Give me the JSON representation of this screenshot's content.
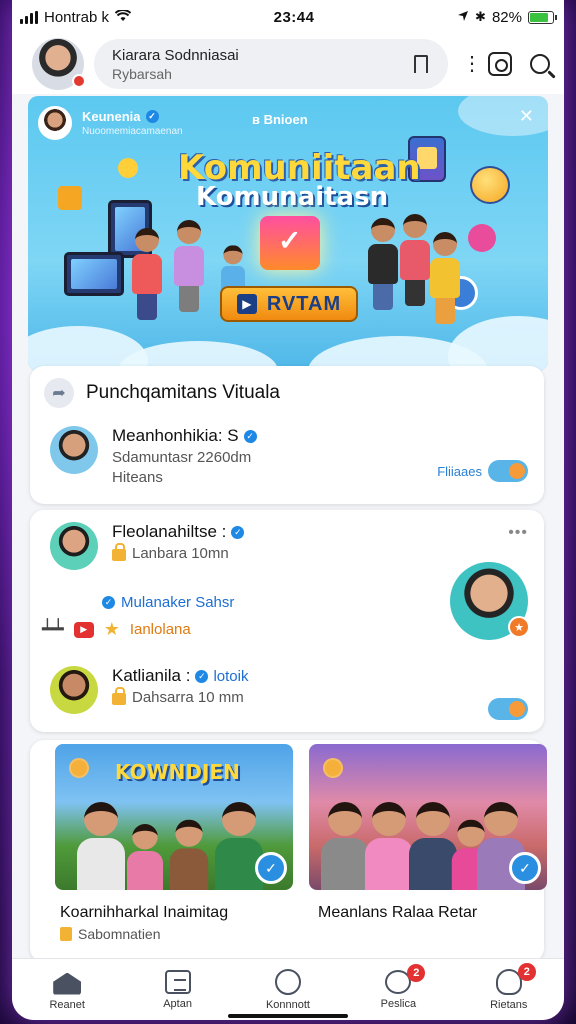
{
  "status_bar": {
    "carrier": "Hontrab k",
    "time": "23:44",
    "battery_text": "82%",
    "battery_level": 0.82
  },
  "header": {
    "search_title": "Kiarara Sodnniasai",
    "search_subtitle": "Rybarsah",
    "icons": [
      "bookmark-icon",
      "more-icon",
      "instagram-icon",
      "search-icon"
    ]
  },
  "banner": {
    "profile_name": "Keunenia",
    "profile_sub": "Nuoomemiacamaenan",
    "brand": "в Bnioen",
    "title_main": "Komuniitaan",
    "title_sub": "Komunaitasn",
    "cta_label": "RVTAM"
  },
  "community_card": {
    "title": "Punchqamitans Vituala",
    "user": {
      "name": "Meanhonhikia: S",
      "line1": "Sdamuntasr 2260dm",
      "line2": "Hiteans",
      "follow_text": "Fliiaaes"
    }
  },
  "post_card": {
    "user1_name": "Fleolanahiltse :",
    "user1_time": "Lanbara 10mn",
    "link_text": "Mulanaker Sahsr",
    "orange_text": "Ianlolana",
    "user2_name": "Katlianila :",
    "user2_tag": "lotoik",
    "user2_time": "Dahsarra 10 mm",
    "more_label": "•••"
  },
  "videos": [
    {
      "thumb_title": "KOWNDJEN",
      "caption": "Koarnihharkal Inaimitag",
      "sub": "Sabomnatien"
    },
    {
      "caption": "Meanlans Ralaa Retar"
    }
  ],
  "bottom_nav": [
    {
      "label": "Reanet",
      "icon": "home-icon"
    },
    {
      "label": "Aptan",
      "icon": "box-icon"
    },
    {
      "label": "Konnnott",
      "icon": "discover-icon"
    },
    {
      "label": "Peslica",
      "icon": "chat-icon",
      "badge": "2"
    },
    {
      "label": "Rietans",
      "icon": "profile-icon",
      "badge": "2"
    }
  ],
  "colors": {
    "accent": "#1e88e5",
    "banner_sky": "#5cc8f0",
    "cta": "#f5a623",
    "badge": "#e33030",
    "background": "#2a0a55"
  }
}
